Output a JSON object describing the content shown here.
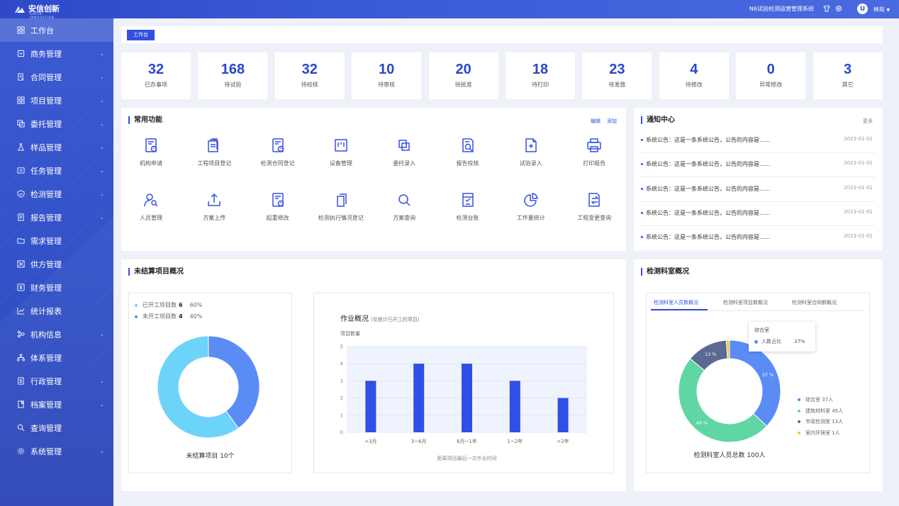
{
  "header": {
    "logo_text": "安信创新",
    "logo_sub": "ANXIN INNOVATION",
    "system_name": "N6试验检测运营管理系统",
    "user_initial": "U",
    "user_name": "林苑"
  },
  "sidebar": {
    "items": [
      {
        "label": "工作台",
        "icon": "grid-icon",
        "active": true,
        "chevron": false
      },
      {
        "label": "商务管理",
        "icon": "handshake-icon",
        "chevron": true
      },
      {
        "label": "合同管理",
        "icon": "contract-icon",
        "chevron": true
      },
      {
        "label": "项目管理",
        "icon": "grid-icon",
        "chevron": true
      },
      {
        "label": "委托管理",
        "icon": "copy-icon",
        "chevron": true
      },
      {
        "label": "样品管理",
        "icon": "flask-icon",
        "chevron": true
      },
      {
        "label": "任务管理",
        "icon": "task-icon",
        "chevron": true
      },
      {
        "label": "检测管理",
        "icon": "shield-icon",
        "chevron": true
      },
      {
        "label": "报告管理",
        "icon": "report-icon",
        "chevron": true
      },
      {
        "label": "需求管理",
        "icon": "folder-icon",
        "chevron": false
      },
      {
        "label": "供方管理",
        "icon": "supplier-icon",
        "chevron": false
      },
      {
        "label": "财务管理",
        "icon": "finance-icon",
        "chevron": false
      },
      {
        "label": "统计报表",
        "icon": "chart-icon",
        "chevron": false
      },
      {
        "label": "机构信息",
        "icon": "org-icon",
        "chevron": true
      },
      {
        "label": "体系管理",
        "icon": "hierarchy-icon",
        "chevron": false
      },
      {
        "label": "行政管理",
        "icon": "admin-icon",
        "chevron": true
      },
      {
        "label": "档案管理",
        "icon": "archive-icon",
        "chevron": true
      },
      {
        "label": "查询管理",
        "icon": "search-icon",
        "chevron": false
      },
      {
        "label": "系统管理",
        "icon": "gear-icon",
        "chevron": true
      }
    ]
  },
  "breadcrumb": {
    "tag": "工作台"
  },
  "stats": [
    {
      "value": "32",
      "label": "已办事项"
    },
    {
      "value": "168",
      "label": "待试验"
    },
    {
      "value": "32",
      "label": "待校核"
    },
    {
      "value": "10",
      "label": "待审核"
    },
    {
      "value": "20",
      "label": "待批准"
    },
    {
      "value": "18",
      "label": "待打印"
    },
    {
      "value": "23",
      "label": "待发放"
    },
    {
      "value": "4",
      "label": "待修改"
    },
    {
      "value": "0",
      "label": "异常修改"
    },
    {
      "value": "3",
      "label": "其它"
    }
  ],
  "functions": {
    "title": "常用功能",
    "edit": "编辑",
    "add": "添加",
    "items": [
      {
        "label": "机构申请",
        "icon": "doc-alert-icon"
      },
      {
        "label": "工程项目登记",
        "icon": "clipboard-icon"
      },
      {
        "label": "检测合同登记",
        "icon": "doc-alert-icon"
      },
      {
        "label": "设备管理",
        "icon": "device-icon"
      },
      {
        "label": "委托录入",
        "icon": "copy-icon"
      },
      {
        "label": "报告校核",
        "icon": "doc-search-icon"
      },
      {
        "label": "试验录入",
        "icon": "doc-plus-icon"
      },
      {
        "label": "打印报告",
        "icon": "printer-icon"
      },
      {
        "label": "人员管理",
        "icon": "user-search-icon"
      },
      {
        "label": "方案上传",
        "icon": "upload-icon"
      },
      {
        "label": "起重修改",
        "icon": "doc-alert-icon"
      },
      {
        "label": "检测执行情况登记",
        "icon": "files-icon"
      },
      {
        "label": "方案查询",
        "icon": "search-icon"
      },
      {
        "label": "检测台账",
        "icon": "ledger-icon"
      },
      {
        "label": "工作量统计",
        "icon": "pie-icon"
      },
      {
        "label": "工程变更查询",
        "icon": "transfer-icon"
      }
    ]
  },
  "notices": {
    "title": "通知中心",
    "more": "更多",
    "items": [
      {
        "text": "系统公告：这是一条系统公告，公告的内容是......",
        "date": "2023-01-01"
      },
      {
        "text": "系统公告：这是一条系统公告，公告的内容是......",
        "date": "2023-01-01"
      },
      {
        "text": "系统公告：这是一条系统公告，公告的内容是......",
        "date": "2023-01-01"
      },
      {
        "text": "系统公告：这是一条系统公告，公告的内容是......",
        "date": "2023-01-01"
      },
      {
        "text": "系统公告：这是一条系统公告，公告的内容是......",
        "date": "2023-01-01"
      }
    ]
  },
  "unsettled": {
    "title": "未结算项目概况"
  },
  "lab": {
    "title": "检测科室概况",
    "tabs": [
      "检测科室人员数概况",
      "检测科室项目数概况",
      "检测科室合同额概况"
    ],
    "tooltip_title": "综合室",
    "tooltip_label": "人数占比",
    "tooltip_value": "37%"
  },
  "colors": {
    "primary": "#3350e0",
    "bar": "#2f4fe6",
    "ring_light": "#6ed3f8",
    "ring_blue": "#5b8cf6",
    "green": "#5fd6a4",
    "slate": "#5a6a93",
    "yellow": "#f7c536"
  },
  "chart_data": [
    {
      "type": "pie",
      "donut": true,
      "legend": [
        {
          "name": "已开工项目数",
          "count": "6",
          "pct": "60%"
        },
        {
          "name": "未开工项目数",
          "count": "4",
          "pct": "40%"
        }
      ],
      "categories": [
        "已开工项目数",
        "未开工项目数"
      ],
      "values": [
        6,
        4
      ],
      "caption": "未结算项目 10个"
    },
    {
      "type": "bar",
      "title": "作业概况",
      "subtitle": "(仅统计已开工的项目)",
      "ylabel": "项目数量",
      "xlabel": "距离项目最后一次作业时间",
      "categories": [
        "<3月",
        "3~6月",
        "6月~1年",
        "1~2年",
        ">2年"
      ],
      "values": [
        3,
        4,
        4,
        3,
        2
      ],
      "ylim": [
        0,
        5
      ],
      "yticks": [
        "0",
        "1",
        "2",
        "3",
        "4",
        "5"
      ],
      "grid": true
    },
    {
      "type": "pie",
      "donut": true,
      "categories": [
        "综合室",
        "建筑材料室",
        "市政检测室",
        "室内环境室"
      ],
      "values": [
        37,
        49,
        13,
        1
      ],
      "slice_labels": [
        "37 %",
        "49 %",
        "13 %"
      ],
      "legend": [
        "综合室   37人",
        "建筑材料室  49人",
        "市政检测室 13人",
        "室内环境室 1人"
      ],
      "caption": "检测科室人员总数 100人"
    }
  ]
}
